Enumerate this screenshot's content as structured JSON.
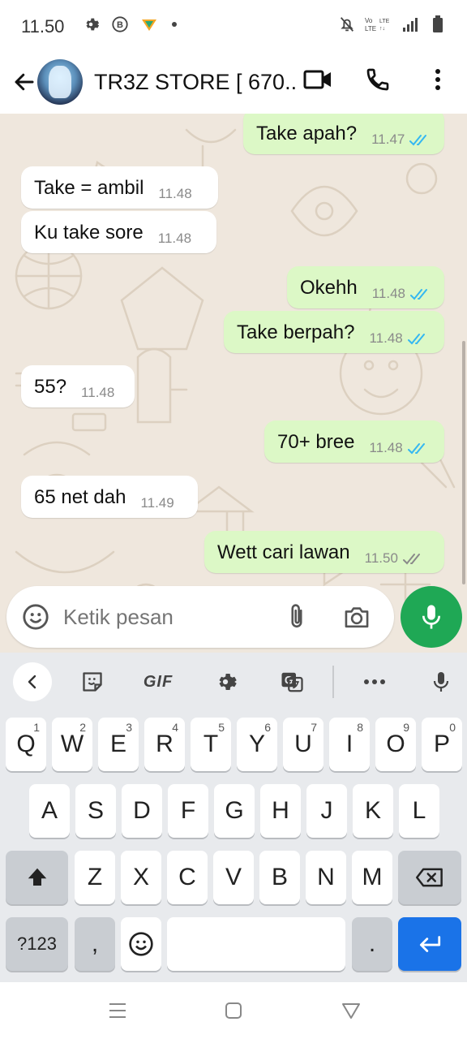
{
  "status_bar": {
    "time": "11.50",
    "network_label": "LTE"
  },
  "header": {
    "title": "TR3Z STORE [ 670..."
  },
  "messages": [
    {
      "dir": "out",
      "text": "Take apah?",
      "time": "11.47",
      "read": true
    },
    {
      "dir": "in",
      "text": "Take = ambil",
      "time": "11.48"
    },
    {
      "dir": "in",
      "text": "Ku take sore",
      "time": "11.48"
    },
    {
      "dir": "out",
      "text": "Okehh",
      "time": "11.48",
      "read": true
    },
    {
      "dir": "out",
      "text": "Take berpah?",
      "time": "11.48",
      "read": true
    },
    {
      "dir": "in",
      "text": "55?",
      "time": "11.48"
    },
    {
      "dir": "out",
      "text": "70+ bree",
      "time": "11.48",
      "read": true
    },
    {
      "dir": "in",
      "text": "65 net dah",
      "time": "11.49"
    },
    {
      "dir": "out",
      "text": "Wett cari lawan",
      "time": "11.50",
      "read": false
    }
  ],
  "input": {
    "placeholder": "Ketik pesan"
  },
  "keyboard": {
    "toolbar": {
      "gif_label": "GIF"
    },
    "row1": [
      {
        "label": "Q",
        "hint": "1"
      },
      {
        "label": "W",
        "hint": "2"
      },
      {
        "label": "E",
        "hint": "3"
      },
      {
        "label": "R",
        "hint": "4"
      },
      {
        "label": "T",
        "hint": "5"
      },
      {
        "label": "Y",
        "hint": "6"
      },
      {
        "label": "U",
        "hint": "7"
      },
      {
        "label": "I",
        "hint": "8"
      },
      {
        "label": "O",
        "hint": "9"
      },
      {
        "label": "P",
        "hint": "0"
      }
    ],
    "row2": [
      "A",
      "S",
      "D",
      "F",
      "G",
      "H",
      "J",
      "K",
      "L"
    ],
    "row3": [
      "Z",
      "X",
      "C",
      "V",
      "B",
      "N",
      "M"
    ],
    "symbols_label": "?123",
    "comma_label": ",",
    "period_label": "."
  },
  "colors": {
    "outgoing_bubble": "#dcf8c6",
    "incoming_bubble": "#ffffff",
    "chat_background": "#efe7dd",
    "mic_button": "#1fa855",
    "read_tick": "#34b7f1",
    "enter_key": "#1a73e8"
  },
  "icons": {
    "status_left": [
      "gear-icon",
      "b-circle-icon",
      "vpn-shield-icon",
      "dot-icon"
    ],
    "status_right": [
      "mute-bell-icon",
      "volte-icon",
      "signal-icon",
      "battery-icon"
    ],
    "header_actions": [
      "video-call-icon",
      "voice-call-icon",
      "more-vert-icon"
    ],
    "input": [
      "emoji-icon",
      "paperclip-icon",
      "camera-icon",
      "microphone-icon"
    ],
    "keyboard_toolbar": [
      "chevron-left-icon",
      "sticker-icon",
      "settings-icon",
      "translate-icon",
      "more-horiz-icon",
      "microphone-icon"
    ],
    "keyboard_special": [
      "shift-icon",
      "backspace-icon",
      "emoji-icon",
      "enter-icon"
    ],
    "nav": [
      "menu-icon",
      "home-icon",
      "back-triangle-icon"
    ]
  }
}
